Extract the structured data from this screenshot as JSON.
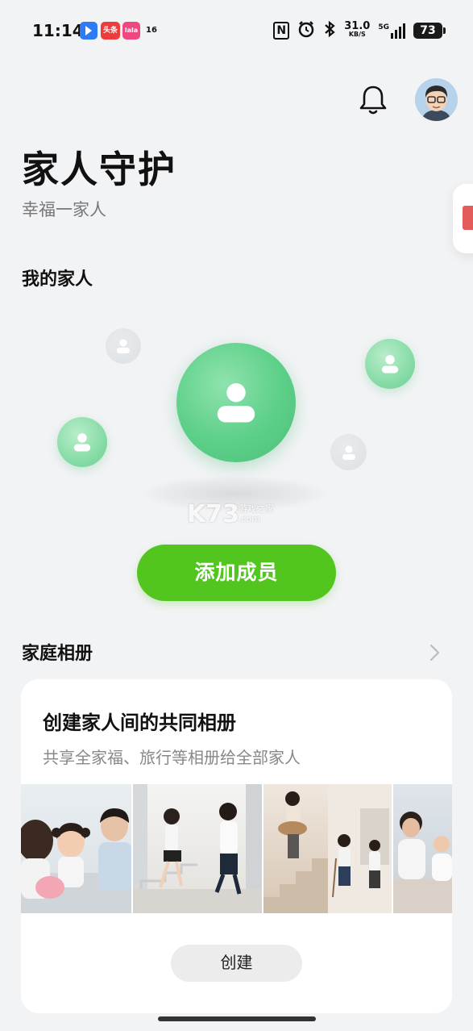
{
  "status_bar": {
    "time": "11:14",
    "app_badge_toutiao": "头条",
    "app_badge_lala": "lala",
    "app_badge_16": "16",
    "nfc_glyph": "N",
    "net_speed_value": "31.0",
    "net_speed_unit": "KB/S",
    "signal_label": "5G",
    "battery_level": "73"
  },
  "header": {
    "bell_icon": "bell-icon",
    "avatar_icon": "avatar-icon",
    "title": "家人守护",
    "subtitle": "幸福一家人"
  },
  "family": {
    "section_title": "我的家人",
    "member_icon": "person-icon",
    "add_button_label": "添加成员"
  },
  "watermark": {
    "text": "K73",
    "sub_line1": "游戏之家",
    "sub_line2": ".com"
  },
  "album": {
    "section_title": "家庭相册",
    "chevron_icon": "chevron-right-icon",
    "card_title": "创建家人间的共同相册",
    "card_description": "共享全家福、旅行等相册给全部家人",
    "create_button_label": "创建"
  },
  "colors": {
    "accent_green": "#52c61f",
    "bubble_green": "#5ccf88",
    "background": "#f2f3f5"
  }
}
